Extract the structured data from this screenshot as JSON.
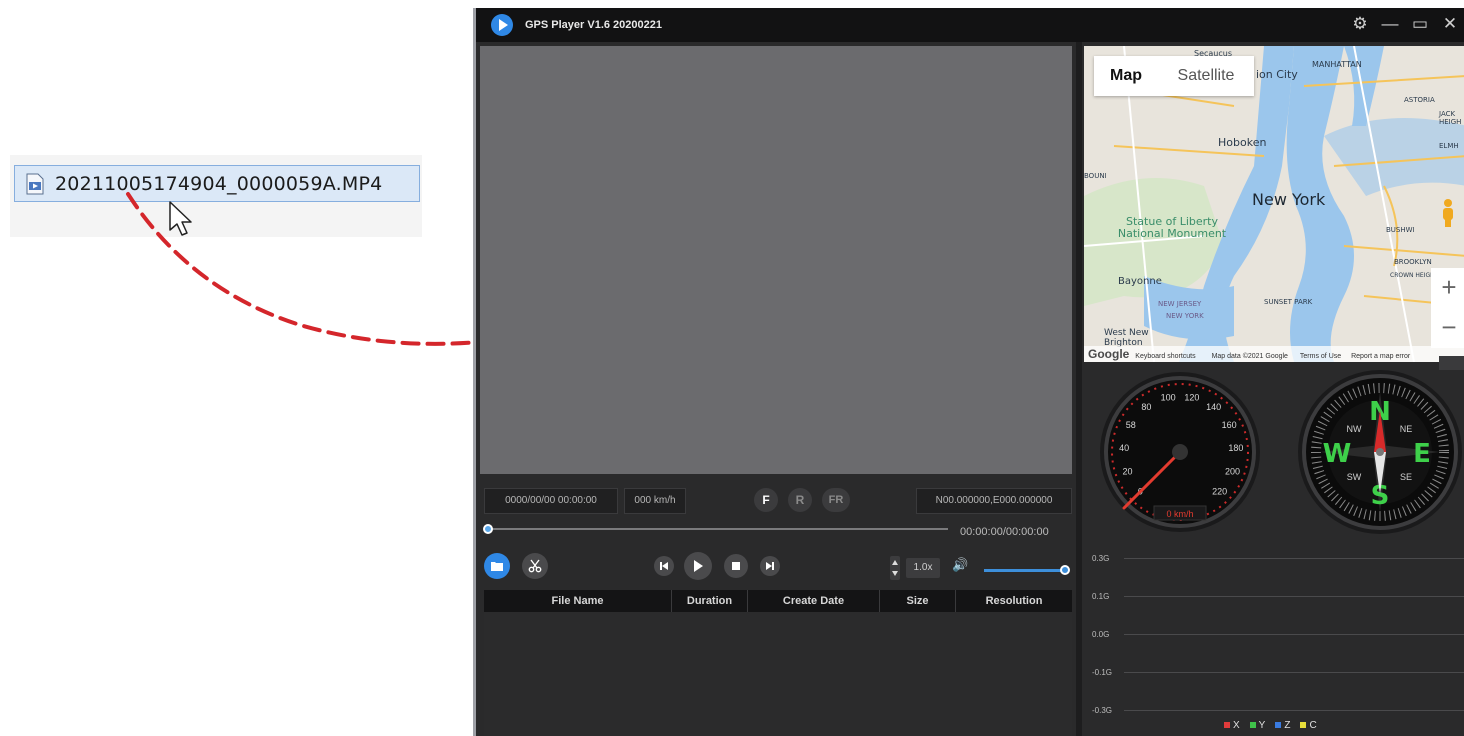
{
  "explorer": {
    "file_name": "20211005174904_0000059A.MP4"
  },
  "app": {
    "title": "GPS Player V1.6 20200221",
    "window_controls": {
      "settings": "⚙",
      "minimize": "—",
      "maximize": "▭",
      "close": "✕"
    }
  },
  "player": {
    "datetime": "0000/00/00 00:00:00",
    "speed": "000 km/h",
    "view_buttons": {
      "front": "F",
      "rear": "R",
      "front_rear": "FR"
    },
    "coordinates": "N00.000000,E000.000000",
    "time": "00:00:00/00:00:00",
    "playback_rate": "1.0x",
    "progress": 0,
    "volume": 1.0,
    "volume_icon": "🔊",
    "colors": {
      "accent": "#3d8fdb",
      "active_button": "#2f88e6"
    }
  },
  "file_table": {
    "columns": [
      "File Name",
      "Duration",
      "Create Date",
      "Size",
      "Resolution"
    ],
    "rows": []
  },
  "map": {
    "tabs": {
      "map": "Map",
      "satellite": "Satellite"
    },
    "labels": {
      "secaucus": "Secaucus",
      "union_city": "ion City",
      "manhattan": "MANHATTAN",
      "astoria": "ASTORIA",
      "jackson_heights": "JACK HEIGH",
      "hoboken": "Hoboken",
      "elmhurst": "ELMH",
      "new_york": "New York",
      "statue": "Statue of Liberty National Monument",
      "bushwick": "BUSHWI",
      "brooklyn": "BROOKLYN",
      "crown_heights": "CROWN HEIGHTS",
      "bayonne": "Bayonne",
      "new_jersey": "NEW JERSEY",
      "new_york_state": "NEW YORK",
      "sunset_park": "SUNSET PARK",
      "west_new_brighton": "West New Brighton",
      "bound": "BOUNI"
    },
    "zoom_in": "+",
    "zoom_out": "−",
    "expand": "›",
    "footer": {
      "google": "Google",
      "shortcuts": "Keyboard shortcuts",
      "map_data": "Map data ©2021 Google",
      "terms": "Terms of Use",
      "report": "Report a map error"
    }
  },
  "speedometer": {
    "ticks": [
      "0",
      "20",
      "40",
      "58",
      "80",
      "100",
      "120",
      "140",
      "160",
      "180",
      "200",
      "220"
    ],
    "readout": "0 km/h",
    "value": 0
  },
  "compass": {
    "cardinals": {
      "n": "N",
      "e": "E",
      "s": "S",
      "w": "W"
    },
    "intercardinals": {
      "ne": "NE",
      "se": "SE",
      "sw": "SW",
      "nw": "NW"
    }
  },
  "gsensor": {
    "axis_labels": [
      "0.3G",
      "0.1G",
      "0.0G",
      "-0.1G",
      "-0.3G"
    ],
    "legend": [
      {
        "label": "X",
        "color": "#e03b3b"
      },
      {
        "label": "Y",
        "color": "#3fc24a"
      },
      {
        "label": "Z",
        "color": "#3a7be0"
      },
      {
        "label": "C",
        "color": "#e6dd3a"
      }
    ]
  }
}
